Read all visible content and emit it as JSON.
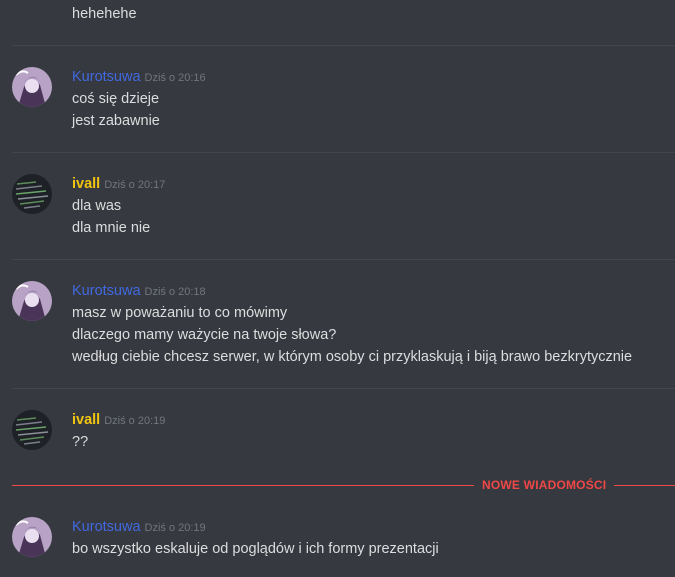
{
  "first_message": {
    "text": "hehehehe"
  },
  "messages": [
    {
      "author": "Kurotsuwa",
      "timestamp": "Dziś o 20:16",
      "lines": [
        "coś się dzieje",
        "jest zabawnie"
      ]
    },
    {
      "author": "ivall",
      "timestamp": "Dziś o 20:17",
      "lines": [
        "dla was",
        "dla mnie nie"
      ]
    },
    {
      "author": "Kurotsuwa",
      "timestamp": "Dziś o 20:18",
      "lines": [
        "masz w poważaniu to co mówimy",
        "dlaczego mamy ważycie na twoje słowa?",
        "według ciebie chcesz serwer, w którym osoby ci przyklaskują i biją brawo bezkrytycznie"
      ]
    },
    {
      "author": "ivall",
      "timestamp": "Dziś o 20:19",
      "lines": [
        "??"
      ]
    },
    {
      "author": "Kurotsuwa",
      "timestamp": "Dziś o 20:19",
      "lines": [
        "bo wszystko eskaluje od poglądów i ich formy prezentacji"
      ]
    }
  ],
  "new_messages_label": "NOWE WIADOMOŚCI",
  "colors": {
    "kurotsuwa": "#4169e1",
    "ivall": "#f1c40f",
    "new_divider": "#f04747"
  }
}
